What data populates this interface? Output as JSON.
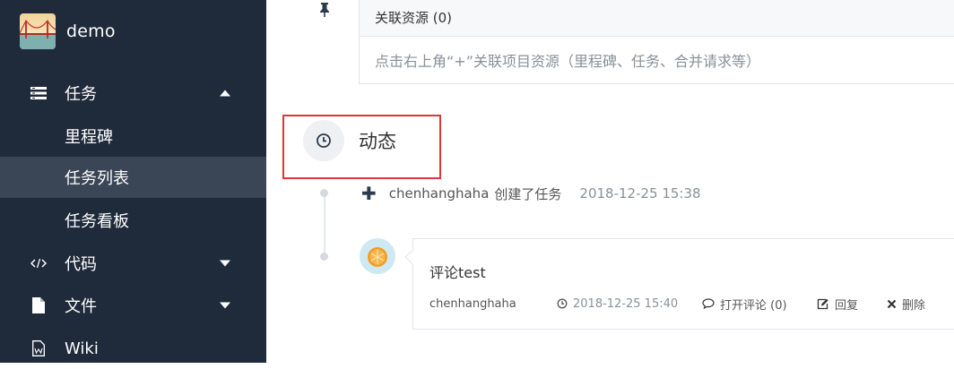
{
  "sidebar": {
    "project_name": "demo",
    "items": [
      {
        "label": "任务",
        "expanded": true
      },
      {
        "label": "代码"
      },
      {
        "label": "文件"
      },
      {
        "label": "Wiki"
      }
    ],
    "task_subitems": [
      {
        "label": "里程碑"
      },
      {
        "label": "任务列表",
        "active": true
      },
      {
        "label": "任务看板"
      }
    ]
  },
  "resources": {
    "header": "关联资源 (0)",
    "hint": "点击右上角“+”关联项目资源（里程碑、任务、合并请求等）"
  },
  "activity": {
    "title": "动态",
    "event": {
      "user": "chenhanghaha",
      "action": "创建了任务",
      "time": "2018-12-25 15:38"
    },
    "comment": {
      "text": "评论test",
      "author": "chenhanghaha",
      "time": "2018-12-25 15:40",
      "open_label": "打开评论 (0)",
      "reply_label": "回复",
      "delete_label": "删除"
    }
  },
  "colors": {
    "sidebar_bg": "#1f2a3a",
    "sidebar_active": "#3a4556",
    "highlight_border": "#e0353b"
  }
}
